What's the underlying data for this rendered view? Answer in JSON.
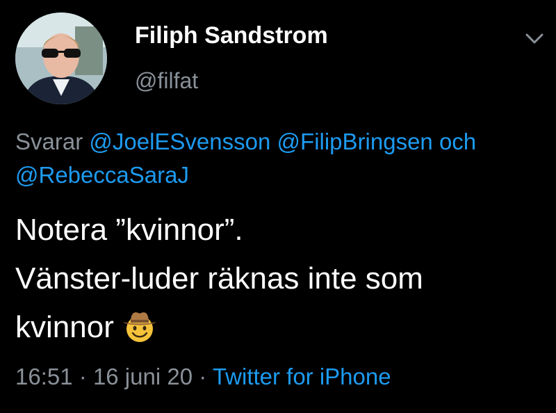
{
  "tweet": {
    "author": {
      "display_name": "Filiph Sandstrom",
      "handle": "@filfat"
    },
    "reply": {
      "prefix": "Svarar",
      "mentions": [
        "@JoelESvensson",
        "@FilipBringsen",
        "@RebeccaSaraJ"
      ],
      "conjunction": "och"
    },
    "text_lines": [
      "Notera ”kvinnor”.",
      "Vänster-luder räknas inte som",
      "kvinnor"
    ],
    "emoji": "cowboy-hat-face",
    "time": "16:51",
    "date": "16 juni 20",
    "separator": "·",
    "source": "Twitter for iPhone"
  },
  "icons": {
    "menu": "chevron-down-icon"
  },
  "colors": {
    "background": "#000000",
    "text": "#ffffff",
    "muted": "#8a9199",
    "link": "#1d9bf0"
  }
}
